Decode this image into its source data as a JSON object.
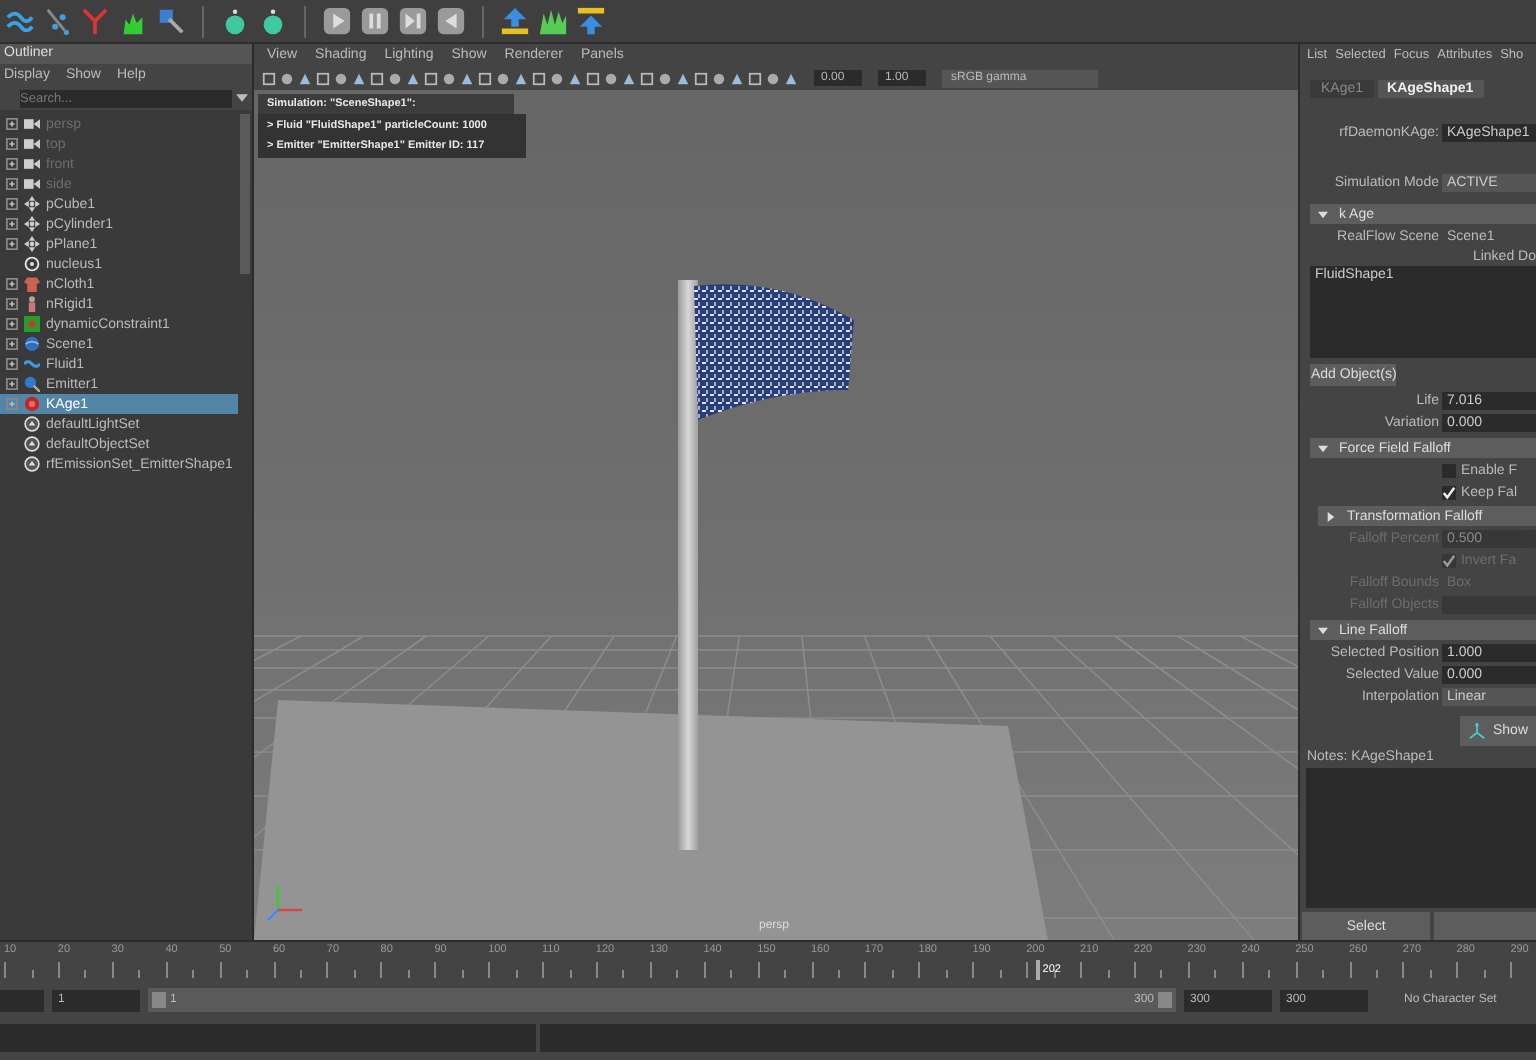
{
  "outliner": {
    "title": "Outliner",
    "menu": [
      "Display",
      "Show",
      "Help"
    ],
    "search": {
      "placeholder": "Search..."
    },
    "items": [
      {
        "label": "persp",
        "kind": "camera",
        "dimmed": true,
        "expandable": true,
        "selected": false
      },
      {
        "label": "top",
        "kind": "camera",
        "dimmed": true,
        "expandable": true,
        "selected": false
      },
      {
        "label": "front",
        "kind": "camera",
        "dimmed": true,
        "expandable": true,
        "selected": false
      },
      {
        "label": "side",
        "kind": "camera",
        "dimmed": true,
        "expandable": true,
        "selected": false
      },
      {
        "label": "pCube1",
        "kind": "transform",
        "dimmed": false,
        "expandable": true,
        "selected": false
      },
      {
        "label": "pCylinder1",
        "kind": "transform",
        "dimmed": false,
        "expandable": true,
        "selected": false
      },
      {
        "label": "pPlane1",
        "kind": "transform",
        "dimmed": false,
        "expandable": true,
        "selected": false
      },
      {
        "label": "nucleus1",
        "kind": "nucleus",
        "dimmed": false,
        "expandable": false,
        "selected": false
      },
      {
        "label": "nCloth1",
        "kind": "cloth",
        "dimmed": false,
        "expandable": true,
        "selected": false
      },
      {
        "label": "nRigid1",
        "kind": "rigid",
        "dimmed": false,
        "expandable": true,
        "selected": false
      },
      {
        "label": "dynamicConstraint1",
        "kind": "constraint",
        "dimmed": false,
        "expandable": true,
        "selected": false
      },
      {
        "label": "Scene1",
        "kind": "scene",
        "dimmed": false,
        "expandable": true,
        "selected": false
      },
      {
        "label": "Fluid1",
        "kind": "fluid",
        "dimmed": false,
        "expandable": true,
        "selected": false
      },
      {
        "label": "Emitter1",
        "kind": "emitter",
        "dimmed": false,
        "expandable": true,
        "selected": false
      },
      {
        "label": "KAge1",
        "kind": "kage",
        "dimmed": false,
        "expandable": true,
        "selected": true
      },
      {
        "label": "defaultLightSet",
        "kind": "set",
        "dimmed": false,
        "expandable": false,
        "selected": false
      },
      {
        "label": "defaultObjectSet",
        "kind": "set",
        "dimmed": false,
        "expandable": false,
        "selected": false
      },
      {
        "label": "rfEmissionSet_EmitterShape1",
        "kind": "set",
        "dimmed": false,
        "expandable": false,
        "selected": false
      }
    ]
  },
  "viewport": {
    "menu": [
      "View",
      "Shading",
      "Lighting",
      "Show",
      "Renderer",
      "Panels"
    ],
    "exposure": "0.00",
    "gamma": "1.00",
    "color_space": "sRGB gamma",
    "hud": [
      "Simulation: \"SceneShape1\":",
      "> Fluid \"FluidShape1\" particleCount: 1000",
      "> Emitter \"EmitterShape1\" Emitter ID: 117"
    ],
    "camera_label": "persp"
  },
  "attribute_editor": {
    "menu": [
      "List",
      "Selected",
      "Focus",
      "Attributes",
      "Sho"
    ],
    "tabs": [
      {
        "label": "KAge1",
        "selected": false
      },
      {
        "label": "KAgeShape1",
        "selected": true
      }
    ],
    "node_field": {
      "label": "rfDaemonKAge:",
      "value": "KAgeShape1"
    },
    "simulation_mode": {
      "label": "Simulation Mode",
      "value": "ACTIVE"
    },
    "sections": [
      {
        "title": "k Age",
        "expanded": true,
        "rows": [
          {
            "kind": "text",
            "label": "RealFlow Scene",
            "value": "Scene1",
            "disabled": false
          },
          {
            "kind": "heading",
            "label": "Linked Do",
            "disabled": false
          },
          {
            "kind": "list",
            "items": [
              "FluidShape1"
            ]
          },
          {
            "kind": "button",
            "label": "Add Object(s)"
          },
          {
            "kind": "field",
            "label": "Life",
            "value": "7.016",
            "disabled": false
          },
          {
            "kind": "field",
            "label": "Variation",
            "value": "0.000",
            "disabled": false
          }
        ]
      },
      {
        "title": "Force Field Falloff",
        "expanded": true,
        "rows": [
          {
            "kind": "checkbox",
            "label": "Enable F",
            "checked": false,
            "disabled": false
          },
          {
            "kind": "checkbox",
            "label": "Keep Fal",
            "checked": true,
            "disabled": false
          },
          {
            "kind": "subheader",
            "label": "Transformation Falloff",
            "expanded": false
          },
          {
            "kind": "field",
            "label": "Falloff Percent",
            "value": "0.500",
            "disabled": true
          },
          {
            "kind": "checkbox",
            "label": "Invert Fa",
            "checked": true,
            "disabled": true
          },
          {
            "kind": "text",
            "label": "Falloff Bounds",
            "value": "Box",
            "disabled": true
          },
          {
            "kind": "field",
            "label": "Falloff Objects",
            "disabled": true
          }
        ]
      },
      {
        "title": "Line Falloff",
        "expanded": true,
        "rows": [
          {
            "kind": "field",
            "label": "Selected Position",
            "value": "1.000",
            "disabled": false
          },
          {
            "kind": "field",
            "label": "Selected Value",
            "value": "0.000",
            "disabled": false
          },
          {
            "kind": "dropdown",
            "label": "Interpolation",
            "value": "Linear",
            "disabled": false
          }
        ]
      }
    ],
    "show_button": "Show",
    "notes_label": "Notes:  KAgeShape1",
    "select_button": "Select"
  },
  "timeline": {
    "level": 0.672,
    "ticks": [
      "10",
      "20",
      "30",
      "40",
      "50",
      "60",
      "70",
      "80",
      "90",
      "100",
      "110",
      "120",
      "130",
      "140",
      "150",
      "160",
      "170",
      "180",
      "190",
      "200",
      "210",
      "220",
      "230",
      "240",
      "250",
      "260",
      "270",
      "280",
      "290"
    ],
    "current_frame": "202"
  },
  "range": {
    "level": 1,
    "start_field": "1",
    "range_start": "1",
    "range_end": "300",
    "end_field": "300",
    "anim_end_field": "300",
    "character_set": "No Character Set"
  }
}
